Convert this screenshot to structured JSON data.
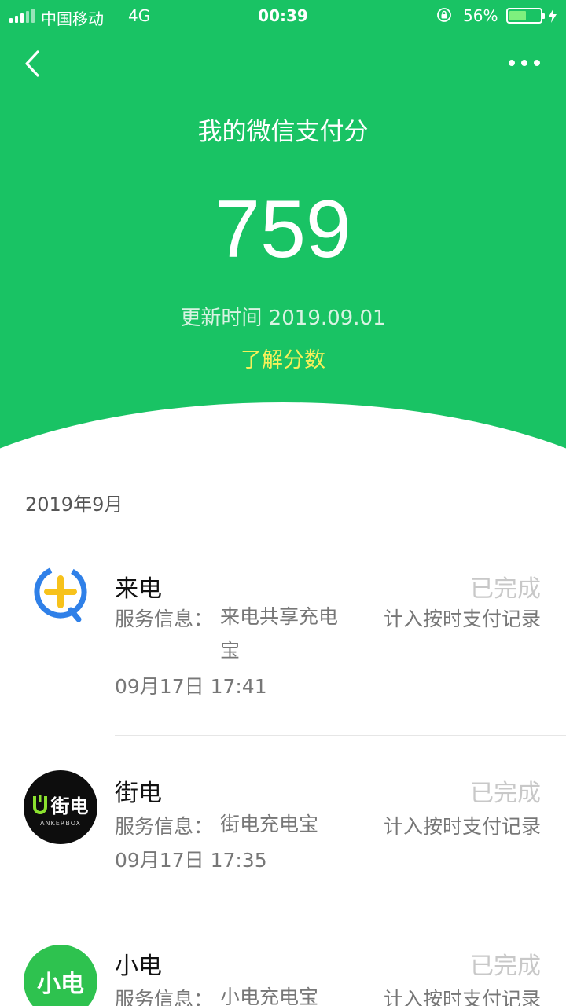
{
  "status_bar": {
    "carrier": "中国移动",
    "network": "4G",
    "time": "00:39",
    "battery_percent": "56%",
    "battery_level": 0.56
  },
  "header": {
    "title": "我的微信支付分",
    "score": "759",
    "update_time": "更新时间 2019.09.01",
    "learn_link": "了解分数",
    "accent_color": "#19c364",
    "link_color": "#f6f05a"
  },
  "records": {
    "month": "2019年9月",
    "items": [
      {
        "name": "来电",
        "status": "已完成",
        "info_label": "服务信息：",
        "info_value": "来电共享充电宝",
        "record_type": "计入按时支付记录",
        "time": "09月17日 17:41",
        "logo": "laidian-logo"
      },
      {
        "name": "街电",
        "status": "已完成",
        "info_label": "服务信息：",
        "info_value": "街电充电宝",
        "record_type": "计入按时支付记录",
        "time": "09月17日 17:35",
        "logo": "jiedian-logo",
        "logo_text": "街电",
        "logo_subtext": "ANKERBOX"
      },
      {
        "name": "小电",
        "status": "已完成",
        "info_label": "服务信息：",
        "info_value": "小电充电宝",
        "record_type": "计入按时支付记录",
        "logo": "xiaodian-logo",
        "logo_text": "小电"
      }
    ]
  }
}
